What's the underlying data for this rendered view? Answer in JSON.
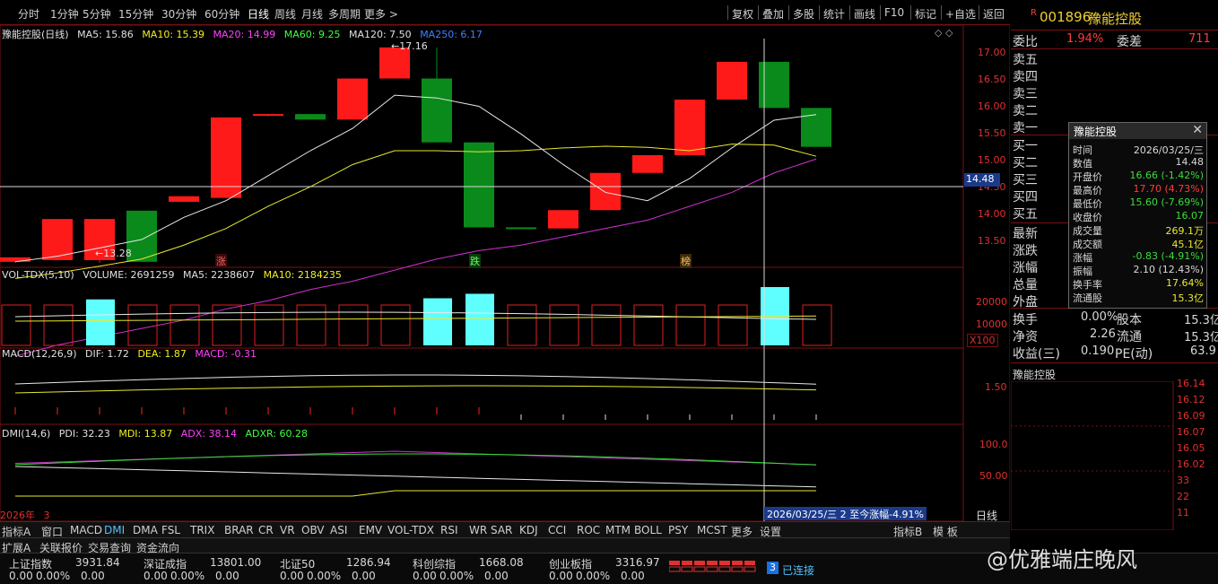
{
  "toolbar": {
    "periods": [
      "分时",
      "1分钟",
      "5分钟",
      "15分钟",
      "30分钟",
      "60分钟",
      "日线",
      "周线",
      "月线",
      "多周期",
      "更多 >"
    ],
    "active_period": "日线",
    "right_buttons": [
      "复权",
      "叠加",
      "多股",
      "统计",
      "画线",
      "F10",
      "标记",
      "+自选",
      "返回"
    ]
  },
  "stock": {
    "flag": "R",
    "code": "001896",
    "name": "豫能控股",
    "chart_title": "豫能控股(日线)"
  },
  "ma_legend": {
    "ma5": "MA5: 15.86",
    "ma10": "MA10: 15.39",
    "ma20": "MA20: 14.99",
    "ma60": "MA60: 9.25",
    "ma120": "MA120: 7.50",
    "ma250": "MA250: 6.17"
  },
  "price_axis": [
    "17.00",
    "16.50",
    "16.00",
    "15.50",
    "15.00",
    "14.50",
    "14.00",
    "13.50"
  ],
  "crosshair_price": "14.48",
  "annotations": {
    "high": "←17.16",
    "low": "←13.28",
    "zhang": "涨",
    "die": "跌",
    "bang": "榜"
  },
  "vol_legend": {
    "name": "VOL-TDX(5,10)",
    "volume": "VOLUME: 2691259",
    "ma5": "MA5: 2238607",
    "ma10": "MA10: 2184235"
  },
  "vol_axis": [
    "20000",
    "10000"
  ],
  "vol_unit": "X100",
  "macd_legend": {
    "name": "MACD(12,26,9)",
    "dif": "DIF: 1.72",
    "dea": "DEA: 1.87",
    "macd": "MACD: -0.31"
  },
  "macd_axis": [
    "1.50"
  ],
  "dmi_legend": {
    "name": "DMI(14,6)",
    "pdi": "PDI: 32.23",
    "mdi": "MDI: 13.87",
    "adx": "ADX: 38.14",
    "adxr": "ADXR: 60.28"
  },
  "dmi_axis": [
    "100.0",
    "50.00"
  ],
  "bottom_info": {
    "year": "2026年",
    "month": "3",
    "status": "2026/03/25/三 2 至今涨幅-4.91%",
    "period": "日线"
  },
  "indicator_tabs": [
    "指标A",
    "窗口",
    "MACD",
    "DMI",
    "DMA",
    "FSL",
    "TRIX",
    "BRAR",
    "CR",
    "VR",
    "OBV",
    "ASI",
    "EMV",
    "VOL-TDX",
    "RSI",
    "WR",
    "SAR",
    "KDJ",
    "CCI",
    "ROC",
    "MTM",
    "BOLL",
    "PSY",
    "MCST",
    "更多",
    "设置"
  ],
  "active_tab": "DMI",
  "indicator_tabs_right": [
    "指标B",
    "模 板"
  ],
  "ext_tabs": [
    "扩展A",
    "关联报价",
    "交易查询",
    "资金流向"
  ],
  "right_panel": {
    "weibi_label": "委比",
    "weibi_value": "1.94%",
    "weicha_label": "委差",
    "weicha_value": "711",
    "sells": [
      "卖五",
      "卖四",
      "卖三",
      "卖二",
      "卖一"
    ],
    "buys": [
      "买一",
      "买二",
      "买三",
      "买四",
      "买五"
    ],
    "stats_left": [
      "最新",
      "涨跌",
      "涨幅",
      "总量",
      "外盘"
    ],
    "turnover": {
      "label": "换手",
      "value": "0.00%",
      "label2": "股本",
      "value2": "15.3亿"
    },
    "netasset": {
      "label": "净资",
      "value": "2.26",
      "label2": "流通",
      "value2": "15.3亿"
    },
    "earnings": {
      "label": "收益(三)",
      "value": "0.190",
      "label2": "PE(动)",
      "value2": "63.9"
    },
    "mini_title": "豫能控股",
    "depth_prices": [
      "16.14",
      "16.12",
      "16.09",
      "16.07",
      "16.05",
      "16.02",
      "33",
      "22",
      "11"
    ]
  },
  "popup": {
    "title": "豫能控股",
    "rows": [
      {
        "k": "时间",
        "v": "2026/03/25/三",
        "c": "#d8d8d8"
      },
      {
        "k": "数值",
        "v": "14.48",
        "c": "#d8d8d8"
      },
      {
        "k": "开盘价",
        "v": "16.66 (-1.42%)",
        "c": "#3cdc3c"
      },
      {
        "k": "最高价",
        "v": "17.70 (4.73%)",
        "c": "#ff3c3c"
      },
      {
        "k": "最低价",
        "v": "15.60 (-7.69%)",
        "c": "#3cdc3c"
      },
      {
        "k": "收盘价",
        "v": "16.07",
        "c": "#3cdc3c"
      },
      {
        "k": "成交量",
        "v": "269.1万",
        "c": "#e8e830"
      },
      {
        "k": "成交额",
        "v": "45.1亿",
        "c": "#e8e830"
      },
      {
        "k": "涨幅",
        "v": "-0.83 (-4.91%)",
        "c": "#3cdc3c"
      },
      {
        "k": "振幅",
        "v": "2.10 (12.43%)",
        "c": "#d8d8d8"
      },
      {
        "k": "换手率",
        "v": "17.64%",
        "c": "#e8e830"
      },
      {
        "k": "流通股",
        "v": "15.3亿",
        "c": "#e8e830"
      }
    ]
  },
  "indices": [
    {
      "name": "上证指数",
      "value": "3931.84",
      "chg": "0.00",
      "pct": "0.00%",
      "amt": "0.00"
    },
    {
      "name": "深证成指",
      "value": "13801.00",
      "chg": "0.00",
      "pct": "0.00%",
      "amt": "0.00"
    },
    {
      "name": "北证50",
      "value": "1286.94",
      "chg": "0.00",
      "pct": "0.00%",
      "amt": "0.00"
    },
    {
      "name": "科创综指",
      "value": "1668.08",
      "chg": "0.00",
      "pct": "0.00%",
      "amt": "0.00"
    },
    {
      "name": "创业板指",
      "value": "3316.97",
      "chg": "0.00",
      "pct": "0.00%",
      "amt": "0.00"
    }
  ],
  "connection": {
    "badge": "3",
    "label": "已连接"
  },
  "watermark": "@优雅端庄晚风",
  "chart_data": {
    "type": "candlestick",
    "series": [
      {
        "open": 13.38,
        "close": 13.3,
        "high": 13.38,
        "low": 13.28,
        "dir": "up"
      },
      {
        "open": 13.33,
        "close": 14.07,
        "high": 14.07,
        "low": 13.33,
        "dir": "up"
      },
      {
        "open": 13.33,
        "close": 14.07,
        "high": 14.07,
        "low": 13.28,
        "dir": "up"
      },
      {
        "open": 14.22,
        "close": 13.3,
        "high": 14.22,
        "low": 13.3,
        "dir": "down"
      },
      {
        "open": 14.38,
        "close": 14.48,
        "high": 14.48,
        "low": 14.38,
        "dir": "up"
      },
      {
        "open": 14.45,
        "close": 15.9,
        "high": 15.9,
        "low": 14.45,
        "dir": "up"
      },
      {
        "open": 15.93,
        "close": 15.96,
        "high": 15.96,
        "low": 15.92,
        "dir": "up"
      },
      {
        "open": 15.86,
        "close": 15.96,
        "high": 15.96,
        "low": 15.86,
        "dir": "down"
      },
      {
        "open": 15.86,
        "close": 16.6,
        "high": 16.6,
        "low": 15.86,
        "dir": "up"
      },
      {
        "open": 16.6,
        "close": 17.16,
        "high": 17.16,
        "low": 16.6,
        "dir": "up"
      },
      {
        "open": 16.6,
        "close": 15.45,
        "high": 17.16,
        "low": 15.45,
        "dir": "down"
      },
      {
        "open": 15.45,
        "close": 13.92,
        "high": 15.45,
        "low": 13.92,
        "dir": "down"
      },
      {
        "open": 13.92,
        "close": 13.92,
        "high": 13.92,
        "low": 13.9,
        "dir": "down"
      },
      {
        "open": 13.9,
        "close": 14.23,
        "high": 14.23,
        "low": 13.9,
        "dir": "up"
      },
      {
        "open": 14.23,
        "close": 14.9,
        "high": 14.9,
        "low": 14.23,
        "dir": "up"
      },
      {
        "open": 14.9,
        "close": 15.22,
        "high": 15.22,
        "low": 14.9,
        "dir": "up"
      },
      {
        "open": 15.22,
        "close": 16.22,
        "high": 16.22,
        "low": 15.22,
        "dir": "up"
      },
      {
        "open": 16.22,
        "close": 16.9,
        "high": 16.9,
        "low": 16.22,
        "dir": "up"
      },
      {
        "open": 16.9,
        "close": 16.07,
        "high": 16.9,
        "low": 16.07,
        "dir": "down"
      },
      {
        "open": 16.07,
        "close": 15.37,
        "high": 16.07,
        "low": 15.37,
        "dir": "down"
      }
    ],
    "ma5": [
      13.3,
      13.4,
      13.55,
      13.7,
      14.1,
      14.4,
      14.85,
      15.3,
      15.7,
      16.3,
      16.25,
      16.1,
      15.6,
      15.05,
      14.55,
      14.4,
      14.8,
      15.35,
      15.85,
      15.95
    ],
    "ma10": [
      13.0,
      13.1,
      13.22,
      13.35,
      13.6,
      13.9,
      14.3,
      14.65,
      15.05,
      15.3,
      15.3,
      15.28,
      15.3,
      15.35,
      15.38,
      15.36,
      15.3,
      15.42,
      15.4,
      15.2
    ],
    "ma20": [
      11.6,
      11.8,
      11.95,
      12.1,
      12.25,
      12.45,
      12.6,
      12.8,
      12.95,
      13.15,
      13.35,
      13.5,
      13.6,
      13.75,
      13.9,
      14.05,
      14.3,
      14.55,
      14.9,
      15.15
    ],
    "volume": [
      0,
      0,
      20500,
      0,
      0,
      0,
      0,
      0,
      0,
      0,
      21000,
      23000,
      0,
      0,
      0,
      0,
      0,
      0,
      26000,
      0
    ],
    "price_ylim": [
      13.2,
      17.4
    ]
  }
}
